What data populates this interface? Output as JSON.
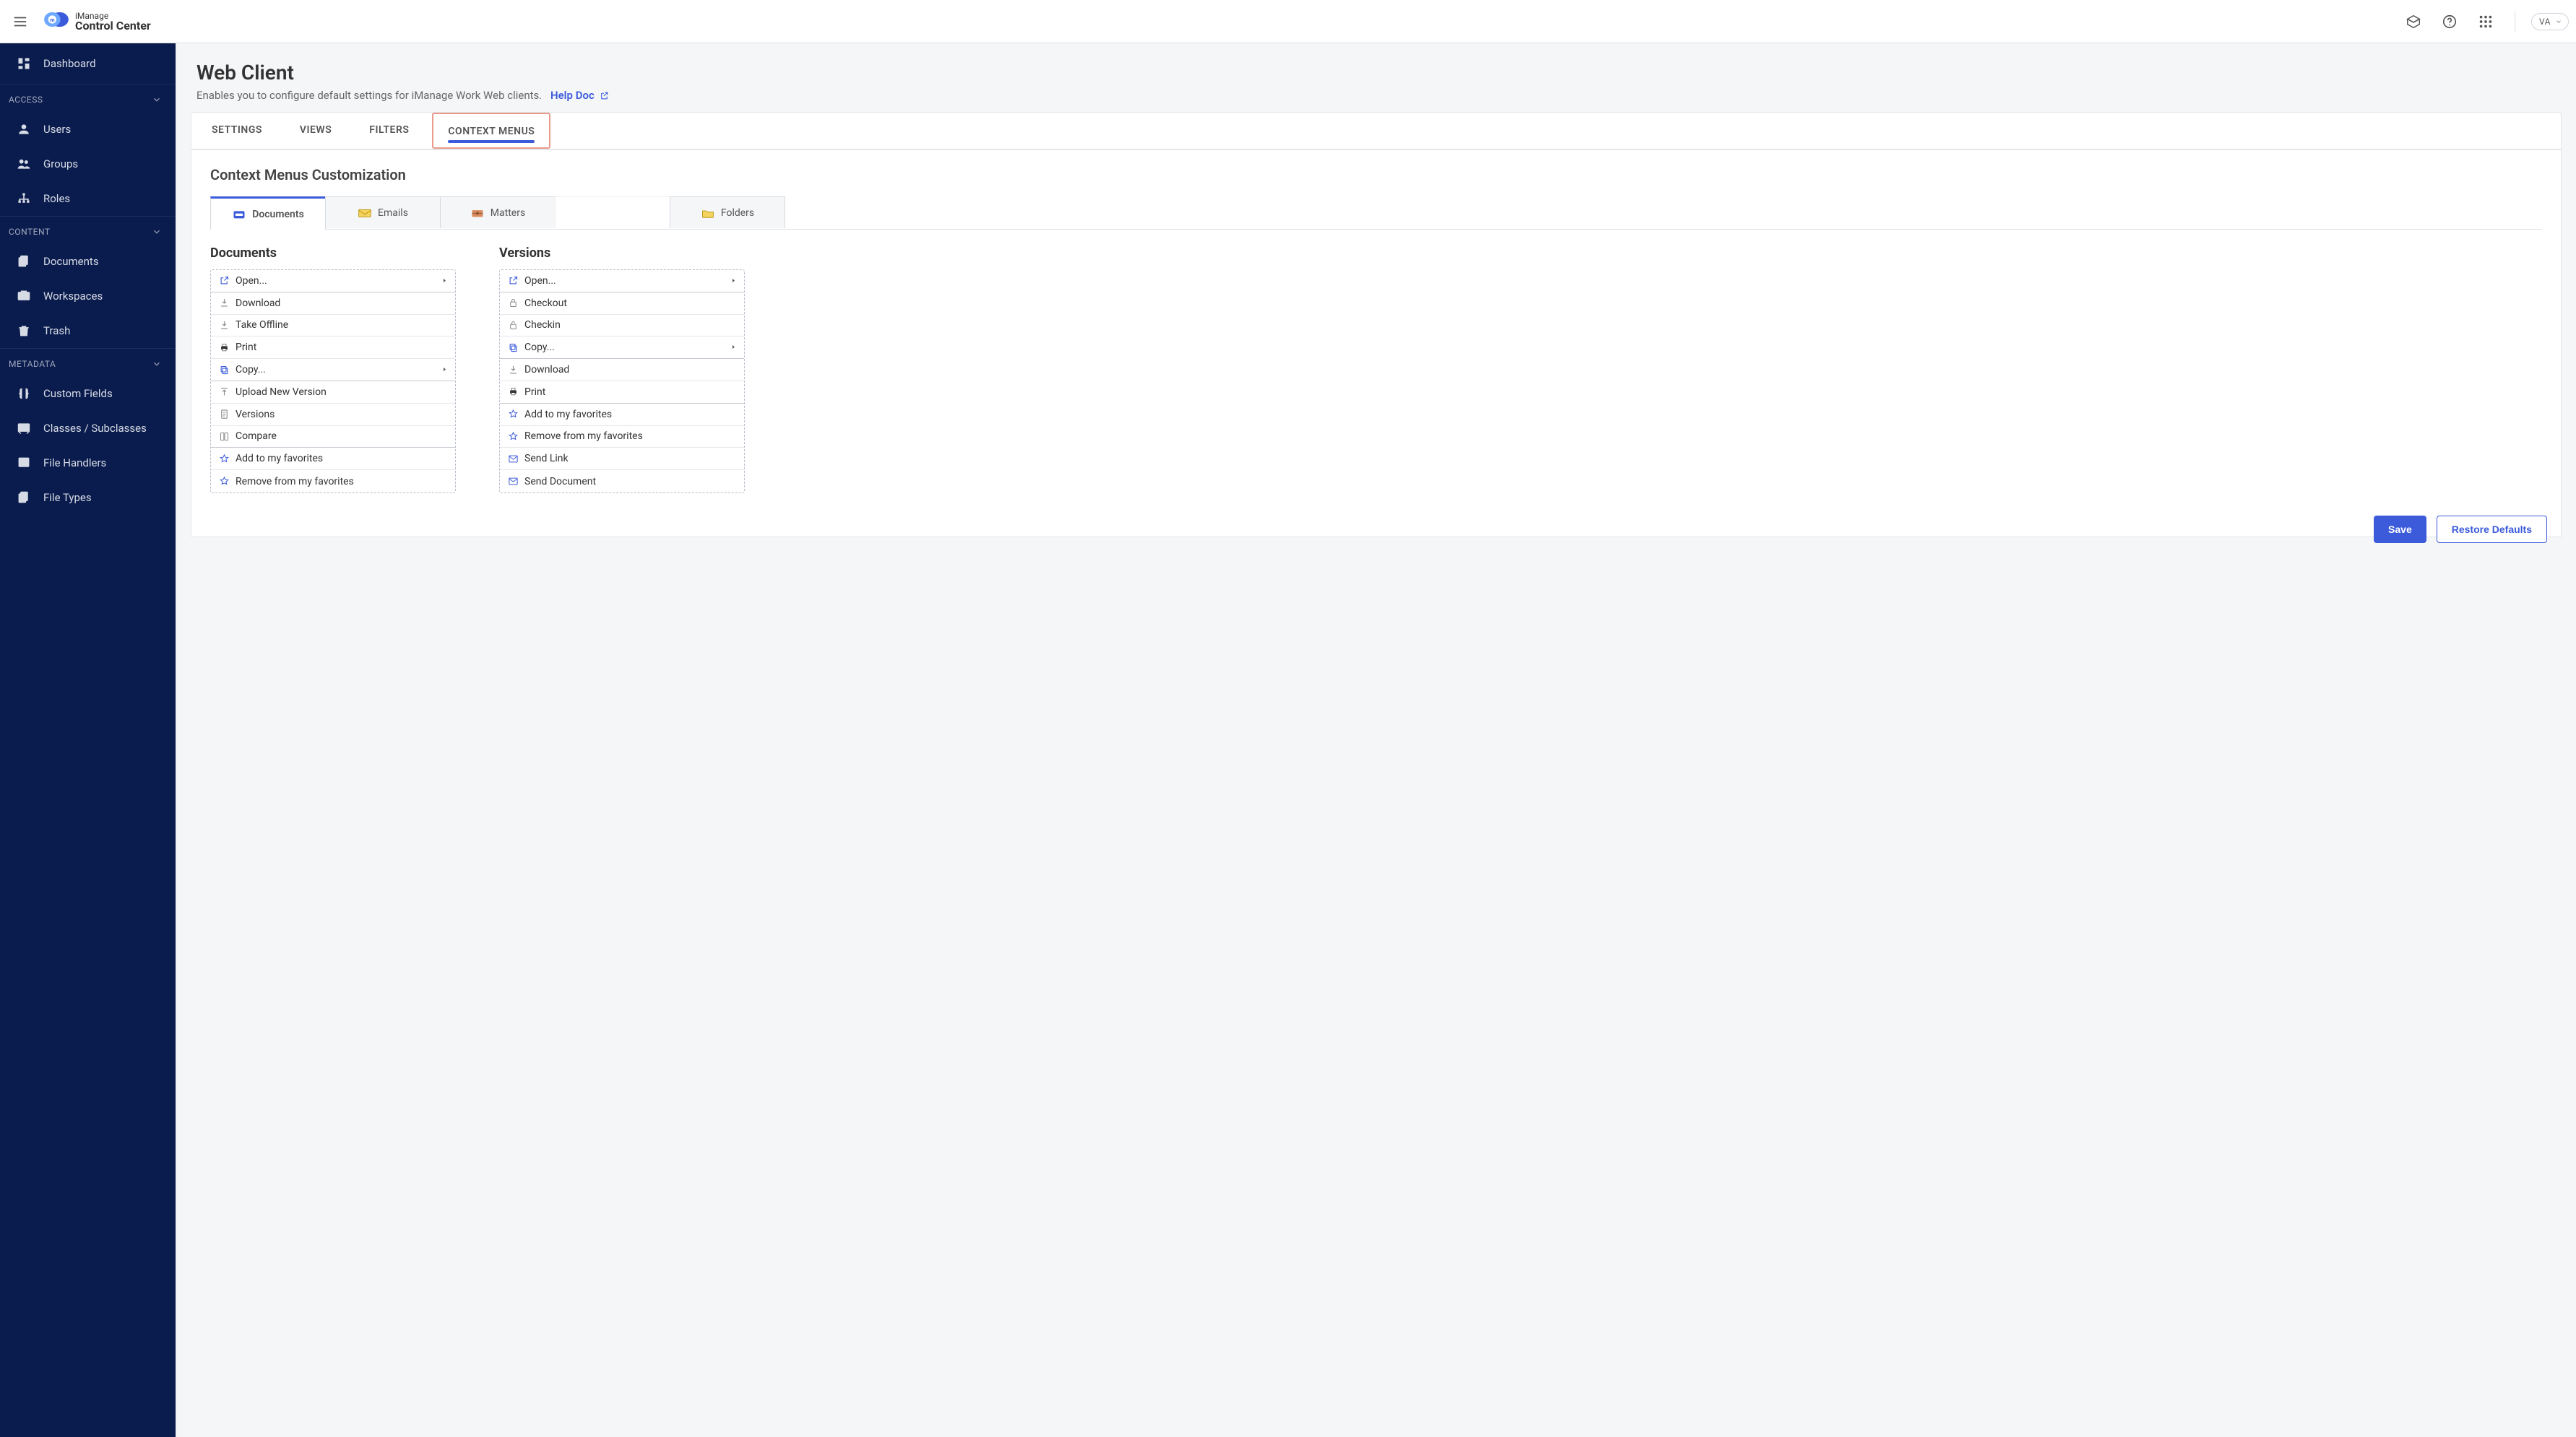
{
  "app": {
    "brand_line1": "iManage",
    "brand_line2": "Control Center",
    "avatar_initials": "VA"
  },
  "sidebar": {
    "dashboard": "Dashboard",
    "sections": {
      "access": "ACCESS",
      "content": "CONTENT",
      "metadata": "METADATA"
    },
    "items": {
      "users": "Users",
      "groups": "Groups",
      "roles": "Roles",
      "documents": "Documents",
      "workspaces": "Workspaces",
      "trash": "Trash",
      "custom_fields": "Custom Fields",
      "classes": "Classes / Subclasses",
      "file_handlers": "File Handlers",
      "file_types": "File Types"
    }
  },
  "page": {
    "title": "Web Client",
    "subtitle": "Enables you to configure default settings for iManage Work Web clients.",
    "help_label": "Help Doc"
  },
  "tabs": {
    "settings": "SETTINGS",
    "views": "VIEWS",
    "filters": "FILTERS",
    "context_menus": "CONTEXT MENUS"
  },
  "panel": {
    "title": "Context Menus Customization",
    "subtabs": {
      "documents": "Documents",
      "emails": "Emails",
      "matters": "Matters",
      "folders": "Folders"
    },
    "columns": {
      "documents_title": "Documents",
      "versions_title": "Versions"
    },
    "doc_menu": [
      {
        "label": "Open...",
        "icon": "open-external",
        "has_submenu": true,
        "sep_after": true
      },
      {
        "label": "Download",
        "icon": "download"
      },
      {
        "label": "Take Offline",
        "icon": "download"
      },
      {
        "label": "Print",
        "icon": "print"
      },
      {
        "label": "Copy...",
        "icon": "copy",
        "has_submenu": true,
        "sep_after": true
      },
      {
        "label": "Upload New Version",
        "icon": "upload"
      },
      {
        "label": "Versions",
        "icon": "doc"
      },
      {
        "label": "Compare",
        "icon": "compare",
        "sep_after": true
      },
      {
        "label": "Add to my favorites",
        "icon": "star"
      },
      {
        "label": "Remove from my favorites",
        "icon": "star"
      }
    ],
    "ver_menu": [
      {
        "label": "Open...",
        "icon": "open-external",
        "has_submenu": true,
        "sep_after": true
      },
      {
        "label": "Checkout",
        "icon": "lock"
      },
      {
        "label": "Checkin",
        "icon": "unlock"
      },
      {
        "label": "Copy...",
        "icon": "copy",
        "has_submenu": true,
        "sep_after": true
      },
      {
        "label": "Download",
        "icon": "download"
      },
      {
        "label": "Print",
        "icon": "print",
        "sep_after": true
      },
      {
        "label": "Add to my favorites",
        "icon": "star"
      },
      {
        "label": "Remove from my favorites",
        "icon": "star"
      },
      {
        "label": "Send Link",
        "icon": "mail"
      },
      {
        "label": "Send Document",
        "icon": "mail"
      }
    ]
  },
  "buttons": {
    "save": "Save",
    "restore": "Restore Defaults"
  }
}
